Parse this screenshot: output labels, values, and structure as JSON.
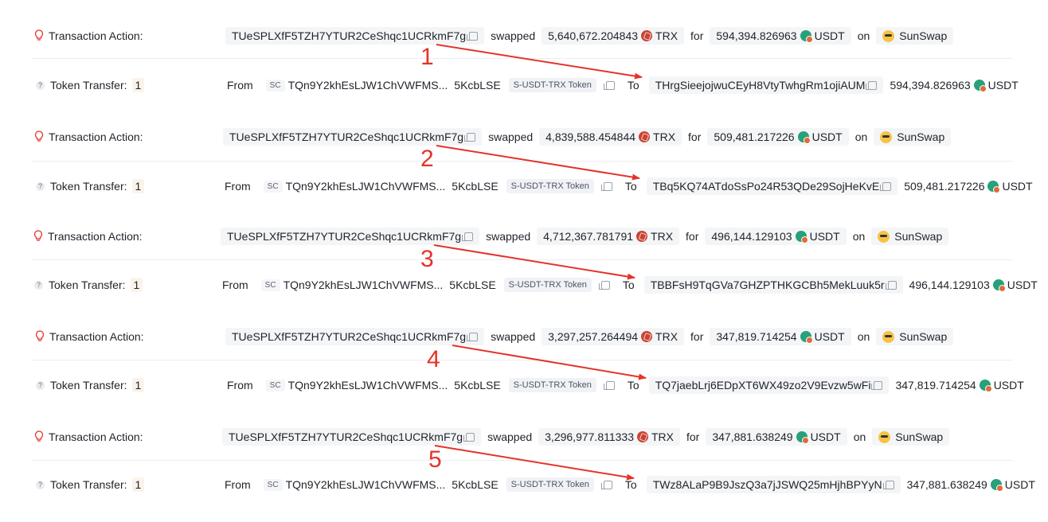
{
  "labels": {
    "transaction_action": "Transaction Action:",
    "token_transfer": "Token Transfer:",
    "transfer_count": "1",
    "swapped": "swapped",
    "for": "for",
    "on": "on",
    "from": "From",
    "to": "To",
    "sc": "SC",
    "token_tag": "S-USDT-TRX Token",
    "trx": "TRX",
    "usdt": "USDT",
    "dex": "SunSwap"
  },
  "colors": {
    "annotation": "#e5332a",
    "trx_icon": "#c8433a",
    "usdt_icon": "#26a17b"
  },
  "icons": [
    "bulb-icon",
    "question-icon",
    "copy-icon",
    "trx-token-icon",
    "usdt-token-icon",
    "sunswap-icon"
  ],
  "records": [
    {
      "marker": "1",
      "actor": "TUeSPLXfF5TZH7YTUR2CeShqc1UCRkmF7g",
      "trx_amount": "5,640,672.204843",
      "usdt_amount": "594,394.826963",
      "from_addr": "TQn9Y2khEsLJW1ChVWFMS...",
      "from_tail": "5KcbLSE",
      "to_addr": "THrgSieejojwuCEyH8VtyTwhgRm1ojiAUM",
      "transfer_amount": "594,394.826963"
    },
    {
      "marker": "2",
      "actor": "TUeSPLXfF5TZH7YTUR2CeShqc1UCRkmF7g",
      "trx_amount": "4,839,588.454844",
      "usdt_amount": "509,481.217226",
      "from_addr": "TQn9Y2khEsLJW1ChVWFMS...",
      "from_tail": "5KcbLSE",
      "to_addr": "TBq5KQ74ATdoSsPo24R53QDe29SojHeKvE",
      "transfer_amount": "509,481.217226"
    },
    {
      "marker": "3",
      "actor": "TUeSPLXfF5TZH7YTUR2CeShqc1UCRkmF7g",
      "trx_amount": "4,712,367.781791",
      "usdt_amount": "496,144.129103",
      "from_addr": "TQn9Y2khEsLJW1ChVWFMS...",
      "from_tail": "5KcbLSE",
      "to_addr": "TBBFsH9TqGVa7GHZPTHKGCBh5MekLuuk5r",
      "transfer_amount": "496,144.129103"
    },
    {
      "marker": "4",
      "actor": "TUeSPLXfF5TZH7YTUR2CeShqc1UCRkmF7g",
      "trx_amount": "3,297,257.264494",
      "usdt_amount": "347,819.714254",
      "from_addr": "TQn9Y2khEsLJW1ChVWFMS...",
      "from_tail": "5KcbLSE",
      "to_addr": "TQ7jaebLrj6EDpXT6WX49zo2V9Evzw5wFi",
      "transfer_amount": "347,819.714254"
    },
    {
      "marker": "5",
      "actor": "TUeSPLXfF5TZH7YTUR2CeShqc1UCRkmF7g",
      "trx_amount": "3,296,977.811333",
      "usdt_amount": "347,881.638249",
      "from_addr": "TQn9Y2khEsLJW1ChVWFMS...",
      "from_tail": "5KcbLSE",
      "to_addr": "TWz8ALaP9B9JszQ3a7jJSWQ25mHjhBPYyN",
      "transfer_amount": "347,881.638249"
    }
  ]
}
